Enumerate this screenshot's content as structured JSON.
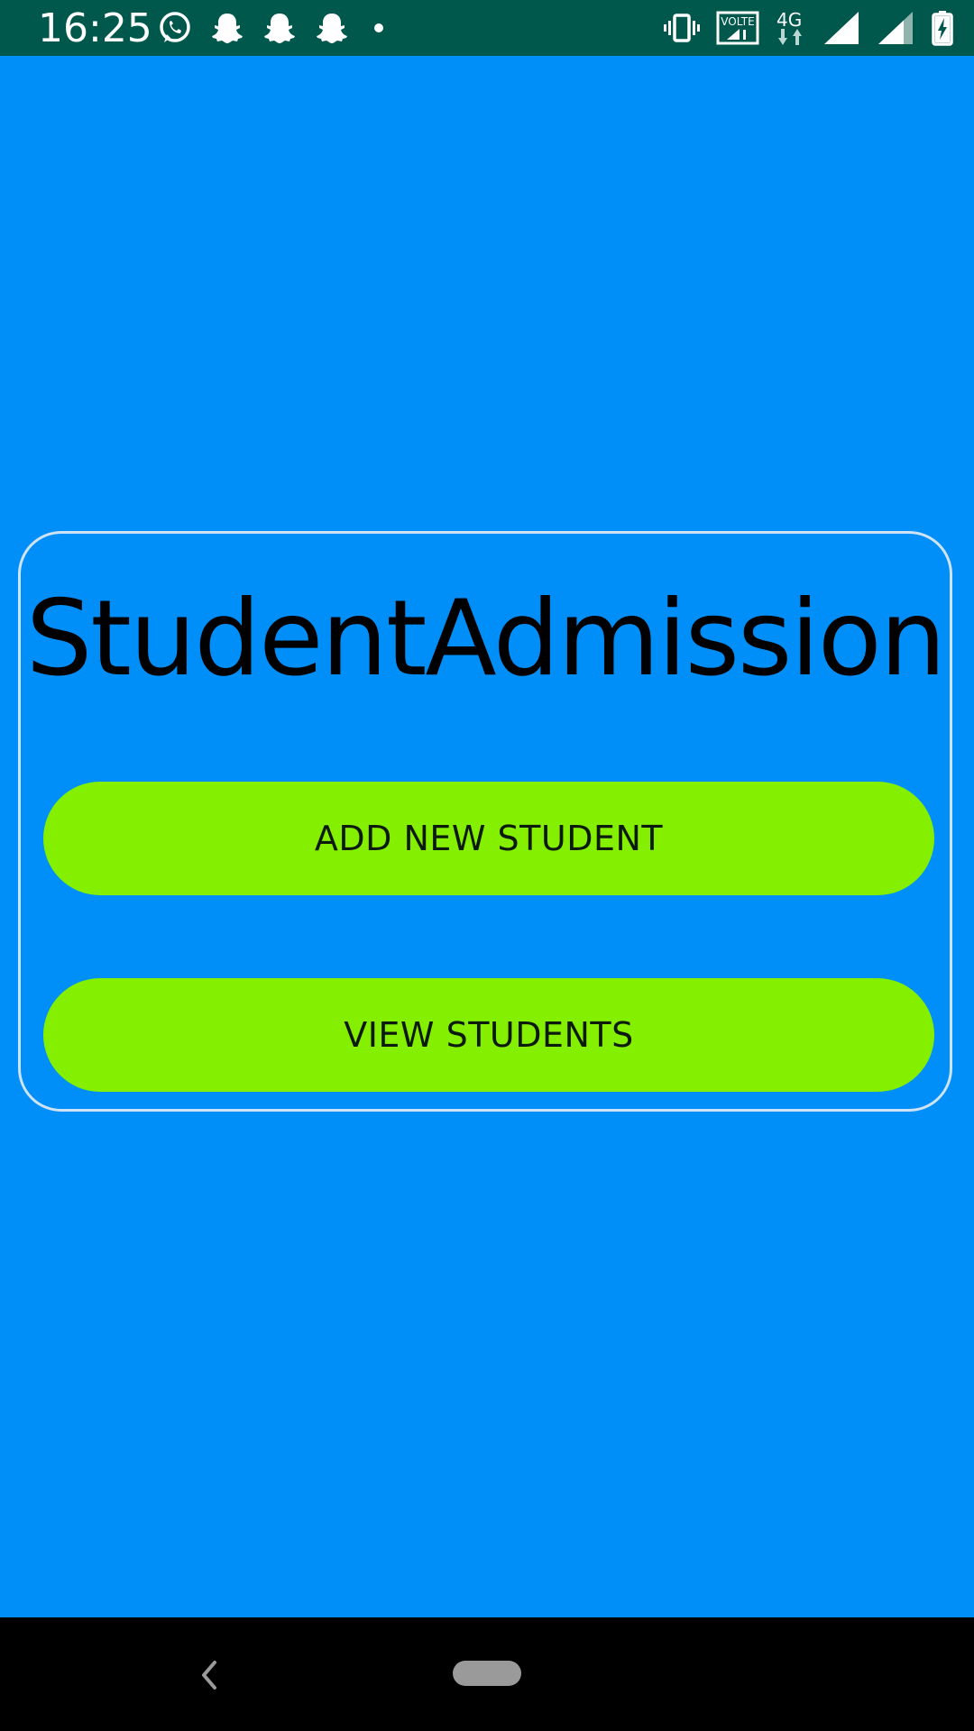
{
  "status_bar": {
    "time": "16:25",
    "left_icons": [
      "whatsapp-icon",
      "snapchat-icon",
      "snapchat-icon",
      "snapchat-icon",
      "notification-dot-icon"
    ],
    "right_icons": [
      "vibrate-icon",
      "volte-icon",
      "network-4g-icon",
      "signal-icon",
      "signal-icon",
      "battery-charging-icon"
    ],
    "volte_label": "VOLTE",
    "network_label": "4G",
    "background": "#00574b"
  },
  "main": {
    "background": "#008ff8",
    "title": "StudentAdmission",
    "add_button_label": "ADD NEW STUDENT",
    "view_button_label": "VIEW STUDENTS",
    "button_color": "#84f000"
  },
  "nav_bar": {
    "icons": [
      "back-icon",
      "home-pill-icon"
    ],
    "background": "#000000"
  }
}
